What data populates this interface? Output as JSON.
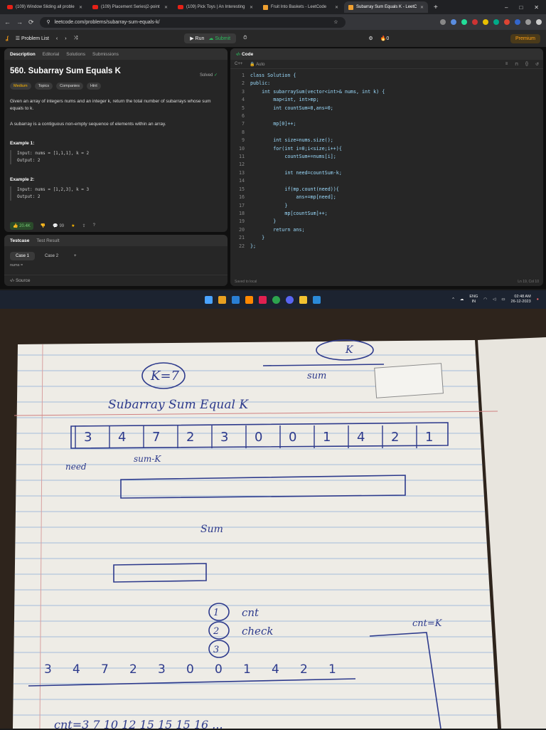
{
  "browser": {
    "tabs": [
      {
        "title": "(109) Window Sliding all proble",
        "icon": "youtube-icon",
        "active": false
      },
      {
        "title": "(109) Placement Series|2-point",
        "icon": "youtube-icon",
        "active": false
      },
      {
        "title": "(109) Pick Toys | An Interesting",
        "icon": "youtube-icon",
        "active": false
      },
      {
        "title": "Fruit Into Baskets - LeetCode",
        "icon": "leetcode-icon",
        "active": false
      },
      {
        "title": "Subarray Sum Equals K - LeetC",
        "icon": "leetcode-icon",
        "active": true
      }
    ],
    "new_tab": "+",
    "window_controls": {
      "minimize": "–",
      "maximize": "□",
      "close": "✕"
    },
    "url": "leetcode.com/problems/subarray-sum-equals-k/"
  },
  "leetcode_header": {
    "problem_list": "Problem List",
    "run": "Run",
    "submit": "Submit",
    "streak": "0",
    "premium": "Premium"
  },
  "description_panel": {
    "tabs": [
      "Description",
      "Editorial",
      "Solutions",
      "Submissions"
    ],
    "title": "560. Subarray Sum Equals K",
    "status": "Solved",
    "tags": [
      "Medium",
      "Topics",
      "Companies",
      "Hint"
    ],
    "statement": "Given an array of integers nums and an integer k, return the total number of subarrays whose sum equals to k.",
    "statement2": "A subarray is a contiguous non-empty sequence of elements within an array.",
    "examples": [
      {
        "label": "Example 1:",
        "input": "Input: nums = [1,1,1], k = 2",
        "output": "Output: 2"
      },
      {
        "label": "Example 2:",
        "input": "Input: nums = [1,2,3], k = 3",
        "output": "Output: 2"
      }
    ],
    "likes": "20.4K",
    "comments": "99"
  },
  "testcase_panel": {
    "tabs": [
      "Testcase",
      "Test Result"
    ],
    "cases": [
      "Case 1",
      "Case 2",
      "+"
    ],
    "field_label": "nums =",
    "footer": "Source"
  },
  "code_panel": {
    "header": "Code",
    "language": "C++",
    "mode": "Auto",
    "lines": [
      "class Solution {",
      "public:",
      "    int subarraySum(vector<int>& nums, int k) {",
      "        map<int, int>mp;",
      "        int countSum=0,ans=0;",
      "",
      "        mp[0]++;",
      "",
      "        int size=nums.size();",
      "        for(int i=0;i<size;i++){",
      "            countSum+=nums[i];",
      "",
      "            int need=countSum-k;",
      "",
      "            if(mp.count(need)){",
      "                ans+=mp[need];",
      "            }",
      "            mp[countSum]++;",
      "        }",
      "        return ans;",
      "    }",
      "};"
    ],
    "saved": "Saved to local",
    "cursor": "Ln 19, Col 10"
  },
  "taskbar": {
    "lang": "ENG",
    "region": "IN",
    "time": "02:48 AM",
    "date": "26-12-2023"
  },
  "notebook": {
    "handwriting": [
      "K=7",
      "Subarray Sum Equal K",
      "sum",
      "K",
      "need",
      "sum-K",
      "Sum",
      "cnt",
      "check",
      "cnt=K"
    ],
    "array": [
      "3",
      "4",
      "7",
      "2",
      "3",
      "0",
      "0",
      "1",
      "4",
      "2",
      "1"
    ],
    "steps": [
      "1",
      "2",
      "3"
    ],
    "bottom_row": [
      "3",
      "4",
      "7",
      "2",
      "3",
      "0",
      "0",
      "1",
      "4",
      "2",
      "1"
    ],
    "counts": "cnt=3  7  10  12  15  15  15  16  ..."
  }
}
